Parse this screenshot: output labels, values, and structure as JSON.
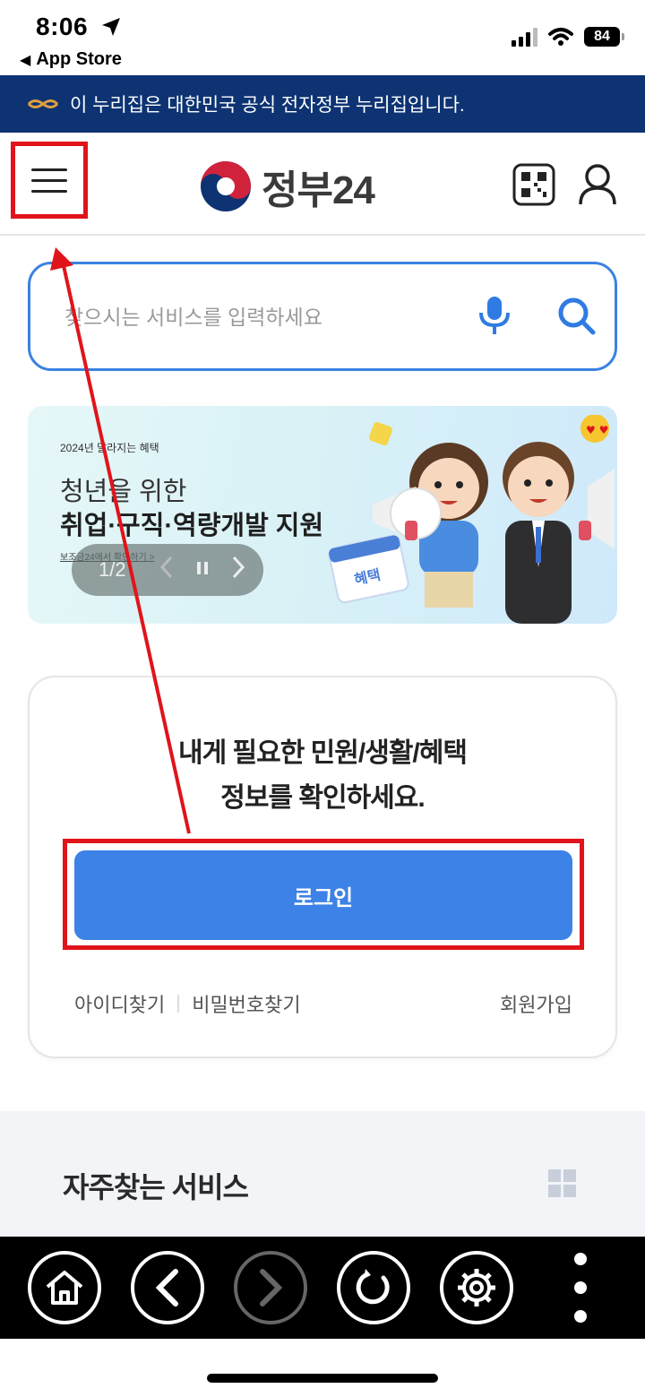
{
  "status_bar": {
    "time": "8:06",
    "back_label": "App Store",
    "battery": "84"
  },
  "gov_banner": {
    "text": "이 누리집은 대한민국 공식 전자정부 누리집입니다."
  },
  "header": {
    "logo_text": "정부24"
  },
  "search": {
    "placeholder": "찾으시는 서비스를 입력하세요"
  },
  "promo": {
    "subtitle": "2024년 달라지는 혜택",
    "title_line1": "청년을 위한",
    "title_line2": "취업·구직·역량개발 지원",
    "link_text": "보조금24에서 확인하기 >",
    "badge": "혜택",
    "counter": "1/2"
  },
  "login_card": {
    "message_line1": "내게 필요한 민원/생활/혜택",
    "message_line2": "정보를 확인하세요.",
    "login_label": "로그인",
    "find_id": "아이디찾기",
    "find_password": "비밀번호찾기",
    "signup": "회원가입"
  },
  "frequent_services": {
    "title": "자주찾는 서비스"
  },
  "colors": {
    "gov_banner": "#0d3373",
    "accent_blue": "#3d82e6",
    "annotation_red": "#e0141a"
  },
  "icons": [
    "location-arrow-icon",
    "signal-icon",
    "wifi-icon",
    "battery-icon",
    "gov-emblem-icon",
    "menu-icon",
    "taegeuk-logo-icon",
    "qr-code-icon",
    "user-icon",
    "mic-icon",
    "search-icon",
    "pause-icon",
    "chevron-left-icon",
    "chevron-right-icon",
    "grid-icon",
    "home-icon",
    "back-icon",
    "forward-icon",
    "reload-icon",
    "gear-icon",
    "more-icon"
  ]
}
